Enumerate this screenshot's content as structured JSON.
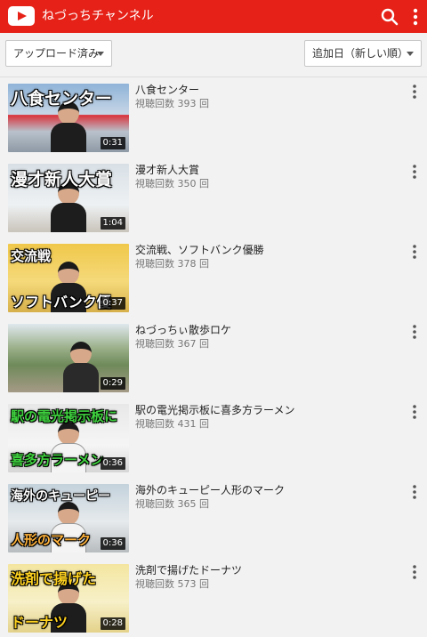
{
  "appbar": {
    "channel_title": "ねづっちチャンネル",
    "icons": {
      "logo": "youtube-logo",
      "search": "search-icon",
      "menu": "more-vert-icon"
    },
    "color": "#e62117"
  },
  "filters": {
    "upload_filter": "アップロード済み",
    "sort": "追加日（新しい順）"
  },
  "videos": [
    {
      "title": "八食センター",
      "views_label": "視聴回数",
      "views": "393",
      "unit": "回",
      "duration": "0:31",
      "thumb_text": "八食センター",
      "thumb_text2": ""
    },
    {
      "title": "漫才新人大賞",
      "views_label": "視聴回数",
      "views": "350",
      "unit": "回",
      "duration": "1:04",
      "thumb_text": "漫才新人大賞",
      "thumb_text2": ""
    },
    {
      "title": "交流戦、ソフトバンク優勝",
      "views_label": "視聴回数",
      "views": "378",
      "unit": "回",
      "duration": "0:37",
      "thumb_text": "交流戦",
      "thumb_text2": "ソフトバンク優"
    },
    {
      "title": "ねづっちぃ散歩ロケ",
      "views_label": "視聴回数",
      "views": "367",
      "unit": "回",
      "duration": "0:29",
      "thumb_text": "",
      "thumb_text2": ""
    },
    {
      "title": "駅の電光掲示板に喜多方ラーメン",
      "views_label": "視聴回数",
      "views": "431",
      "unit": "回",
      "duration": "0:36",
      "thumb_text": "駅の電光掲示板に",
      "thumb_text2": "喜多方ラーメン"
    },
    {
      "title": "海外のキューピー人形のマーク",
      "views_label": "視聴回数",
      "views": "365",
      "unit": "回",
      "duration": "0:36",
      "thumb_text": "海外のキューピー",
      "thumb_text2": "人形のマーク"
    },
    {
      "title": "洗剤で揚げたドーナツ",
      "views_label": "視聴回数",
      "views": "573",
      "unit": "回",
      "duration": "0:28",
      "thumb_text": "洗剤で揚げた",
      "thumb_text2": "ドーナツ"
    }
  ]
}
